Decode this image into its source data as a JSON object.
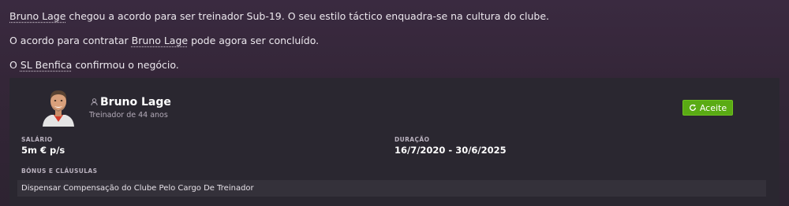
{
  "news": {
    "line1_name": "Bruno Lage",
    "line1_rest": " chegou a acordo para ser treinador Sub-19. O seu estilo táctico enquadra-se na cultura do clube.",
    "line2_pre": "O acordo para contratar ",
    "line2_name": "Bruno Lage",
    "line2_post": " pode agora ser concluído.",
    "line3_pre": "O ",
    "line3_club": "SL Benfica",
    "line3_post": " confirmou o negócio."
  },
  "contract": {
    "person_name": "Bruno Lage",
    "person_subtitle": "Treinador de 44 anos",
    "accept_label": "Aceite",
    "salary_label": "SALÁRIO",
    "salary_value": "5m € p/s",
    "duration_label": "DURAÇÃO",
    "duration_value": "16/7/2020 - 30/6/2025",
    "bonus_label": "BÓNUS E CLÁUSULAS",
    "clauses": [
      "Dispensar Compensação do Clube Pelo Cargo De Treinador"
    ]
  },
  "icons": {
    "person": "person-icon",
    "accept": "refresh-icon"
  },
  "colors": {
    "accept_button": "#5aab14",
    "card_background": "#2a2730",
    "page_background": "#342638"
  }
}
